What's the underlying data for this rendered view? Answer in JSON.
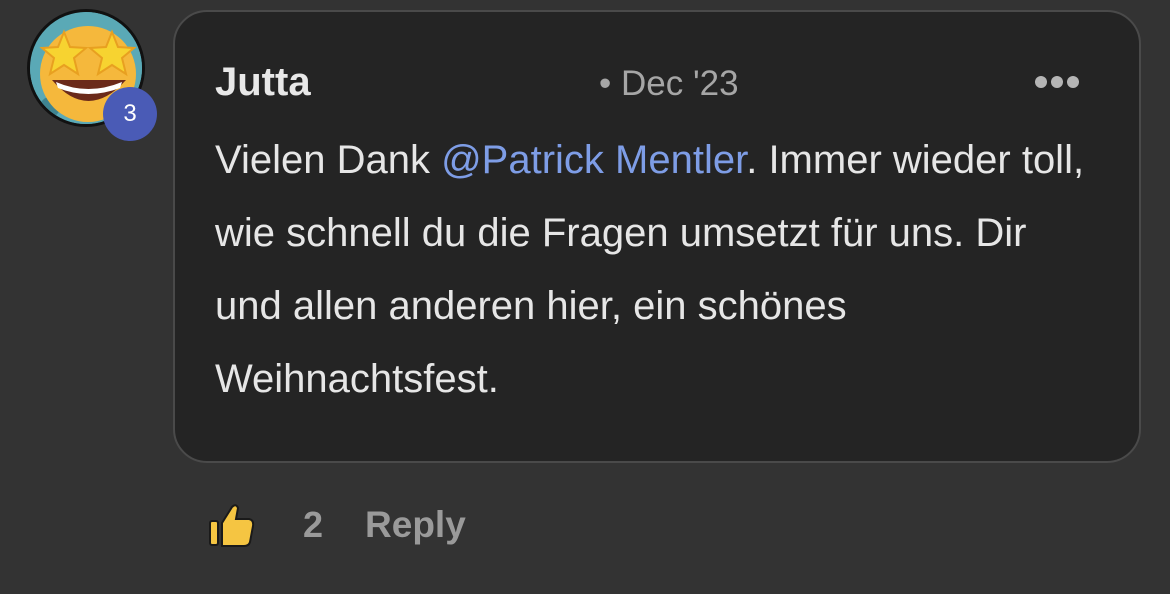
{
  "comment": {
    "author": "Jutta",
    "date": "• Dec '23",
    "level": "3",
    "text_before": "Vielen Dank ",
    "mention": "@Patrick Mentler",
    "text_after": ". Immer wieder toll, wie schnell du die Fragen umsetzt für uns. Dir und allen anderen hier, ein schönes Weihnachtsfest."
  },
  "actions": {
    "like_count": "2",
    "reply_label": "Reply"
  },
  "icons": {
    "avatar": "star-struck-emoji-icon",
    "more": "more-horizontal-icon",
    "like": "thumbs-up-icon"
  },
  "colors": {
    "mention": "#7e9de6",
    "badge": "#4a5bb6",
    "background": "#333333",
    "bubble": "#242424"
  }
}
